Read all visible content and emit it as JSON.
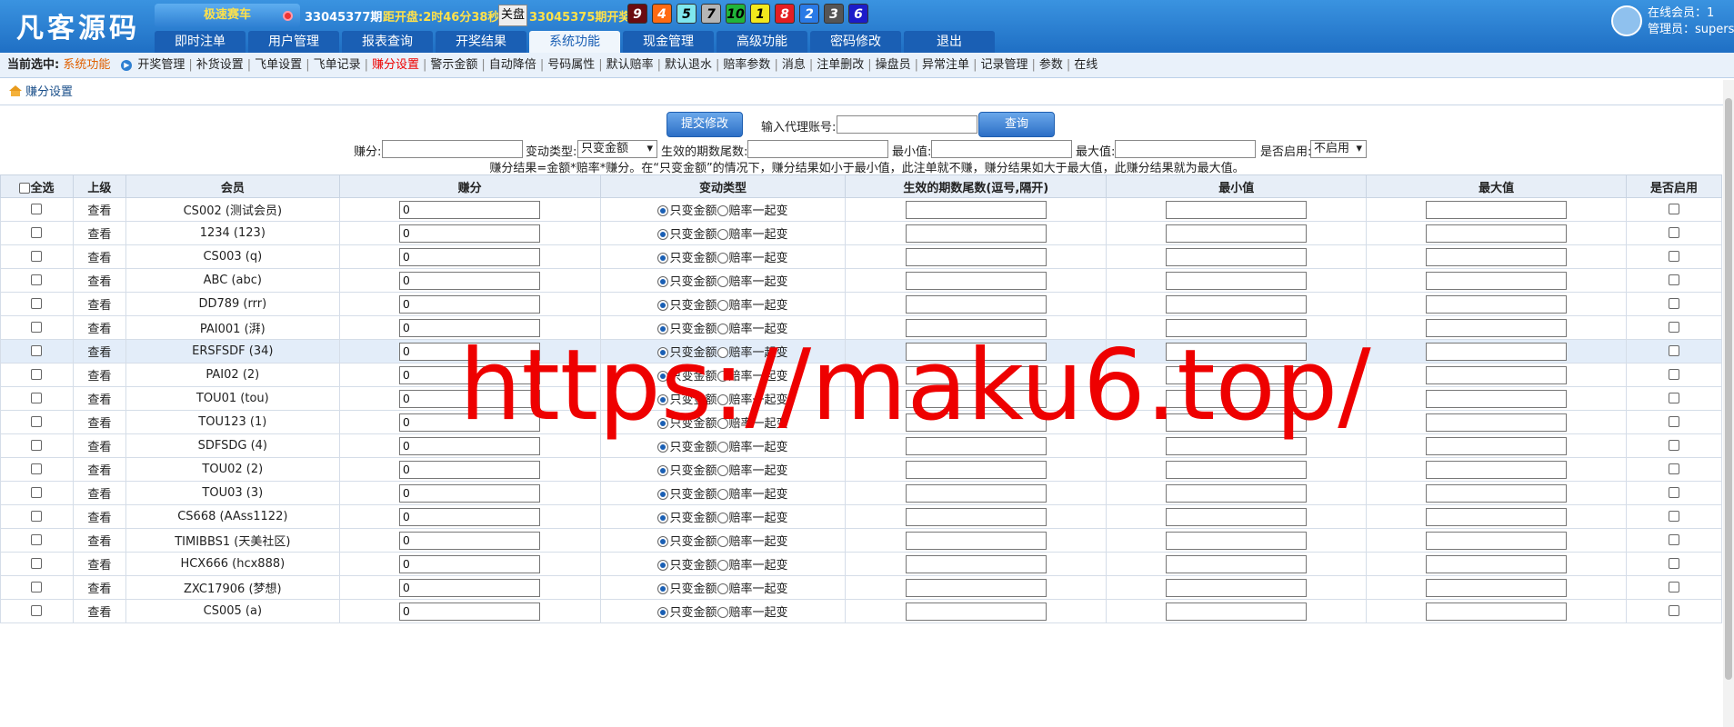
{
  "header": {
    "logo": "凡客源码",
    "game_button": "极速赛车",
    "period_current": "33045377期",
    "countdown": "距开盘:2时46分38秒",
    "close_label": "关盘",
    "period_last": "33045375期开奖:",
    "balls": [
      {
        "n": "9",
        "bg": "#6b0c10",
        "fg": "#fff"
      },
      {
        "n": "4",
        "bg": "#ff6a13",
        "fg": "#fff"
      },
      {
        "n": "5",
        "bg": "#7fe7ee",
        "fg": "#000"
      },
      {
        "n": "7",
        "bg": "#b5b5b5",
        "fg": "#000"
      },
      {
        "n": "10",
        "bg": "#21b53a",
        "fg": "#000"
      },
      {
        "n": "1",
        "bg": "#f2e81c",
        "fg": "#000"
      },
      {
        "n": "8",
        "bg": "#e41e22",
        "fg": "#fff"
      },
      {
        "n": "2",
        "bg": "#2a7ae6",
        "fg": "#fff"
      },
      {
        "n": "3",
        "bg": "#555",
        "fg": "#fff"
      },
      {
        "n": "6",
        "bg": "#1c1cc9",
        "fg": "#fff"
      }
    ],
    "nav": [
      "即时注单",
      "用户管理",
      "报表查询",
      "开奖结果",
      "系统功能",
      "现金管理",
      "高级功能",
      "密码修改",
      "退出"
    ],
    "nav_active": "系统功能",
    "online": "在线会员：1",
    "admin": "管理员：supers"
  },
  "subnav": {
    "label": "当前选中:",
    "current": "系统功能",
    "items": [
      "开奖管理",
      "补货设置",
      "飞单设置",
      "飞单记录",
      "赚分设置",
      "警示金额",
      "自动降倍",
      "号码属性",
      "默认赔率",
      "默认退水",
      "赔率参数",
      "消息",
      "注单删改",
      "操盘员",
      "异常注单",
      "记录管理",
      "参数",
      "在线"
    ],
    "selected": "赚分设置"
  },
  "breadcrumb": "赚分设置",
  "form": {
    "submit": "提交修改",
    "agent_label": "输入代理账号:",
    "query": "查询",
    "earn_label": "赚分:",
    "type_label": "变动类型:",
    "type_value": "只变金额",
    "period_label": "生效的期数尾数:",
    "min_label": "最小值:",
    "max_label": "最大值:",
    "enable_label": "是否启用:",
    "enable_value": "不启用",
    "note": "赚分结果=金额*赔率*赚分。在“只变金额”的情况下，赚分结果如小于最小值，此注单就不赚，赚分结果如大于最大值，此赚分结果就为最大值。"
  },
  "table": {
    "headers": [
      "全选",
      "上级",
      "会员",
      "赚分",
      "变动类型",
      "生效的期数尾数(逗号,隔开)",
      "最小值",
      "最大值",
      "是否启用"
    ],
    "view": "查看",
    "radio1": "只变金额",
    "radio2": "赔率一起变",
    "rows": [
      {
        "member": "CS002 (测试会员)",
        "earn": "0"
      },
      {
        "member": "1234 (123)",
        "earn": "0"
      },
      {
        "member": "CS003 (q)",
        "earn": "0"
      },
      {
        "member": "ABC (abc)",
        "earn": "0"
      },
      {
        "member": "DD789 (rrr)",
        "earn": "0"
      },
      {
        "member": "PAI001 (湃)",
        "earn": "0"
      },
      {
        "member": "ERSFSDF (34)",
        "earn": "0"
      },
      {
        "member": "PAI02 (2)",
        "earn": "0"
      },
      {
        "member": "TOU01 (tou)",
        "earn": "0"
      },
      {
        "member": "TOU123 (1)",
        "earn": "0"
      },
      {
        "member": "SDFSDG (4)",
        "earn": "0"
      },
      {
        "member": "TOU02 (2)",
        "earn": "0"
      },
      {
        "member": "TOU03 (3)",
        "earn": "0"
      },
      {
        "member": "CS668 (AAss1122)",
        "earn": "0"
      },
      {
        "member": "TIMIBBS1 (天美社区)",
        "earn": "0"
      },
      {
        "member": "HCX666 (hcx888)",
        "earn": "0"
      },
      {
        "member": "ZXC17906 (梦想)",
        "earn": "0"
      },
      {
        "member": "CS005 (a)",
        "earn": "0"
      }
    ]
  },
  "watermark": "https://maku6.top/"
}
